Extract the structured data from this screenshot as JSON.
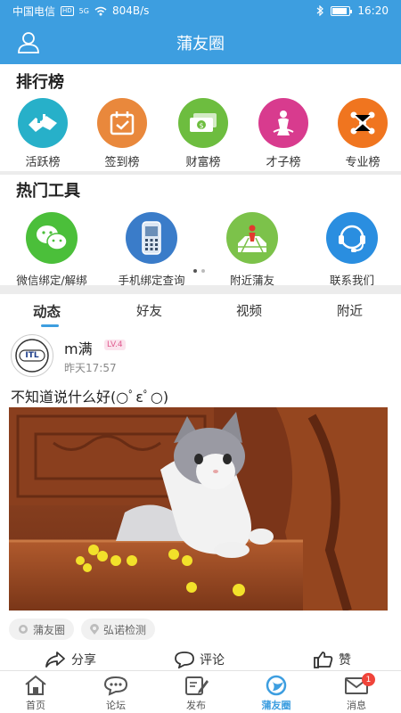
{
  "status_bar": {
    "carrier": "中国电信",
    "net_tag": "HD",
    "net_type": "5G",
    "speed": "804B/s",
    "time": "16:20",
    "battery_level": 0.85
  },
  "header": {
    "title": "蒲友圈",
    "icon": "user-icon"
  },
  "ranking": {
    "title": "排行榜",
    "items": [
      {
        "label": "活跃榜",
        "icon": "handshake-icon",
        "color": "#27b0c9"
      },
      {
        "label": "签到榜",
        "icon": "calendar-check-icon",
        "color": "#e9883c"
      },
      {
        "label": "财富榜",
        "icon": "money-icon",
        "color": "#6dbd3f"
      },
      {
        "label": "才子榜",
        "icon": "scholar-icon",
        "color": "#d83b8e"
      },
      {
        "label": "专业榜",
        "icon": "network-icon",
        "color": "#f0751f"
      }
    ]
  },
  "tools": {
    "title": "热门工具",
    "items": [
      {
        "label": "微信绑定/解绑",
        "icon": "wechat-icon",
        "color": "#4bbf3a"
      },
      {
        "label": "手机绑定查询",
        "icon": "phone-icon",
        "color": "#3a7cc9"
      },
      {
        "label": "附近蒲友",
        "icon": "map-pin-icon",
        "color": "#7cc24a"
      },
      {
        "label": "联系我们",
        "icon": "headset-icon",
        "color": "#2a8ee0"
      }
    ],
    "page_count": 2,
    "current_page": 1
  },
  "feed_tabs": [
    "动态",
    "好友",
    "视频",
    "附近"
  ],
  "active_tab": "动态",
  "post": {
    "avatar_text": "ITL",
    "username": "m满",
    "level": "LV.4",
    "time": "昨天17:57",
    "content": "不知道说什么好(○ﾟεﾟ○)",
    "tags": [
      {
        "label": "蒲友圈",
        "icon": "circle-icon"
      },
      {
        "label": "弘诺检测",
        "icon": "location-icon"
      }
    ],
    "actions": [
      {
        "label": "分享",
        "icon": "share-icon"
      },
      {
        "label": "评论",
        "icon": "comment-icon"
      },
      {
        "label": "赞",
        "icon": "thumbs-up-icon"
      }
    ]
  },
  "bottom_nav": {
    "items": [
      {
        "label": "首页",
        "icon": "home-icon"
      },
      {
        "label": "论坛",
        "icon": "forum-icon"
      },
      {
        "label": "发布",
        "icon": "edit-icon"
      },
      {
        "label": "蒲友圈",
        "icon": "circle-logo-icon"
      },
      {
        "label": "消息",
        "icon": "mail-icon"
      }
    ],
    "active": "蒲友圈",
    "message_badge": "1",
    "accent": "#3d9ee0"
  }
}
